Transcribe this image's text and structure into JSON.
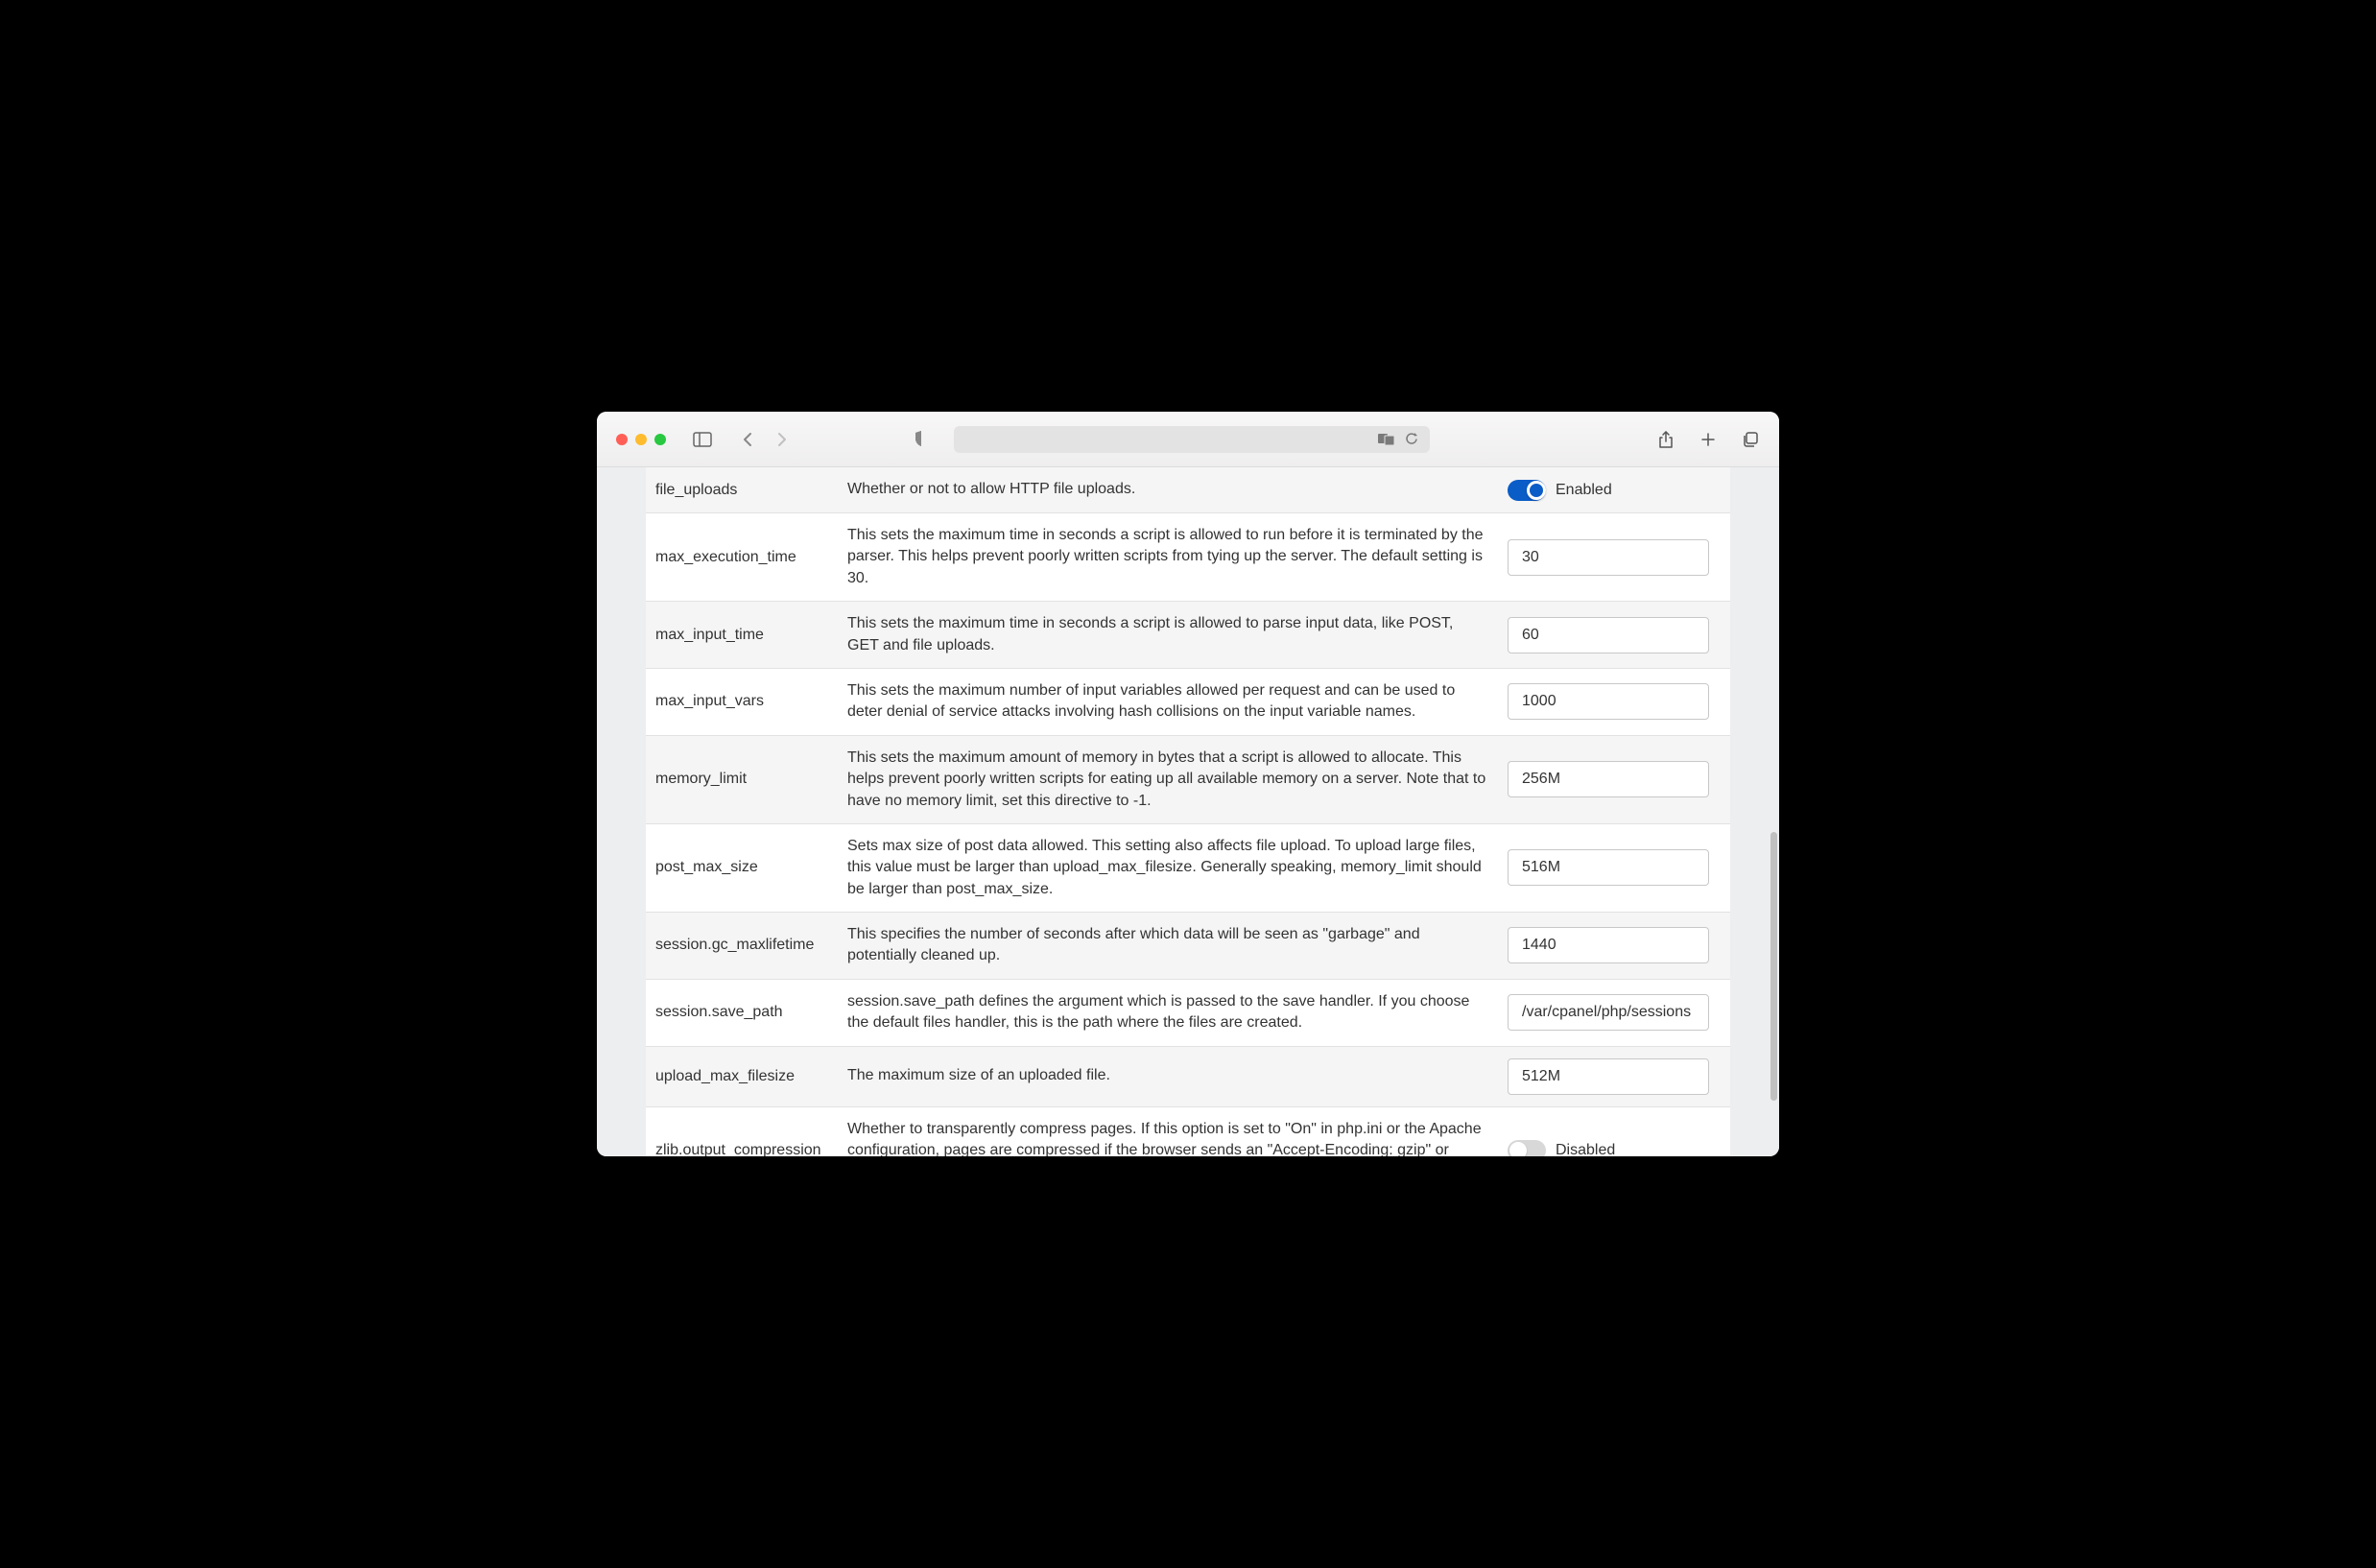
{
  "toggle_labels": {
    "enabled": "Enabled",
    "disabled": "Disabled"
  },
  "settings": [
    {
      "name": "file_uploads",
      "description": "Whether or not to allow HTTP file uploads.",
      "type": "toggle",
      "value": true
    },
    {
      "name": "max_execution_time",
      "description": "This sets the maximum time in seconds a script is allowed to run before it is terminated by the parser. This helps prevent poorly written scripts from tying up the server. The default setting is 30.",
      "type": "text",
      "value": "30"
    },
    {
      "name": "max_input_time",
      "description": "This sets the maximum time in seconds a script is allowed to parse input data, like POST, GET and file uploads.",
      "type": "text",
      "value": "60"
    },
    {
      "name": "max_input_vars",
      "description": "This sets the maximum number of input variables allowed per request and can be used to deter denial of service attacks involving hash collisions on the input variable names.",
      "type": "text",
      "value": "1000"
    },
    {
      "name": "memory_limit",
      "description": "This sets the maximum amount of memory in bytes that a script is allowed to allocate. This helps prevent poorly written scripts for eating up all available memory on a server. Note that to have no memory limit, set this directive to -1.",
      "type": "text",
      "value": "256M"
    },
    {
      "name": "post_max_size",
      "description": "Sets max size of post data allowed. This setting also affects file upload. To upload large files, this value must be larger than upload_max_filesize. Generally speaking, memory_limit should be larger than post_max_size.",
      "type": "text",
      "value": "516M"
    },
    {
      "name": "session.gc_maxlifetime",
      "description": "This specifies the number of seconds after which data will be seen as \"garbage\" and potentially cleaned up.",
      "type": "text",
      "value": "1440"
    },
    {
      "name": "session.save_path",
      "description": "session.save_path defines the argument which is passed to the save handler. If you choose the default files handler, this is the path where the files are created.",
      "type": "text",
      "value": "/var/cpanel/php/sessions"
    },
    {
      "name": "upload_max_filesize",
      "description": "The maximum size of an uploaded file.",
      "type": "text",
      "value": "512M"
    },
    {
      "name": "zlib.output_compression",
      "description": "Whether to transparently compress pages. If this option is set to \"On\" in php.ini or the Apache configuration, pages are compressed if the browser sends an \"Accept-Encoding: gzip\" or \"deflate\" header.",
      "type": "toggle",
      "value": false
    }
  ]
}
